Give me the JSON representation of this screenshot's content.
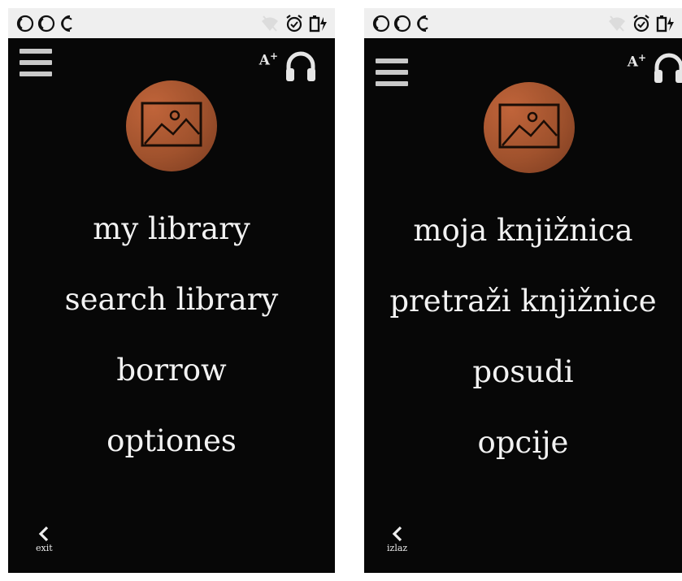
{
  "screens": [
    {
      "language": "english",
      "status_bar": {
        "left_icons": [
          "notification-icon",
          "notification-icon",
          "notification-icon"
        ],
        "right_icons": [
          "wifi-off-icon",
          "alarm-icon",
          "battery-charging-icon"
        ]
      },
      "header": {
        "menu_icon": "hamburger-icon",
        "font_size_label": "A",
        "font_size_sup": "+",
        "audio_icon": "headphones-icon"
      },
      "avatar_icon": "image-placeholder-icon",
      "menu": [
        "my library",
        "search library",
        "borrow",
        "optiones"
      ],
      "back_label": "exit"
    },
    {
      "language": "croatian",
      "status_bar": {
        "left_icons": [
          "notification-icon",
          "notification-icon",
          "notification-icon"
        ],
        "right_icons": [
          "wifi-off-icon",
          "alarm-icon",
          "battery-charging-icon"
        ]
      },
      "header": {
        "menu_icon": "hamburger-icon",
        "font_size_label": "A",
        "font_size_sup": "+",
        "audio_icon": "headphones-icon"
      },
      "avatar_icon": "image-placeholder-icon",
      "menu": [
        "moja knjižnica",
        "pretraži knjižnice",
        "posudi",
        "opcije"
      ],
      "back_label": "izlaz"
    }
  ],
  "colors": {
    "screen_bg": "#070707",
    "status_bg": "#efefef",
    "avatar": "#a0522d",
    "text": "#f2f2f2"
  }
}
